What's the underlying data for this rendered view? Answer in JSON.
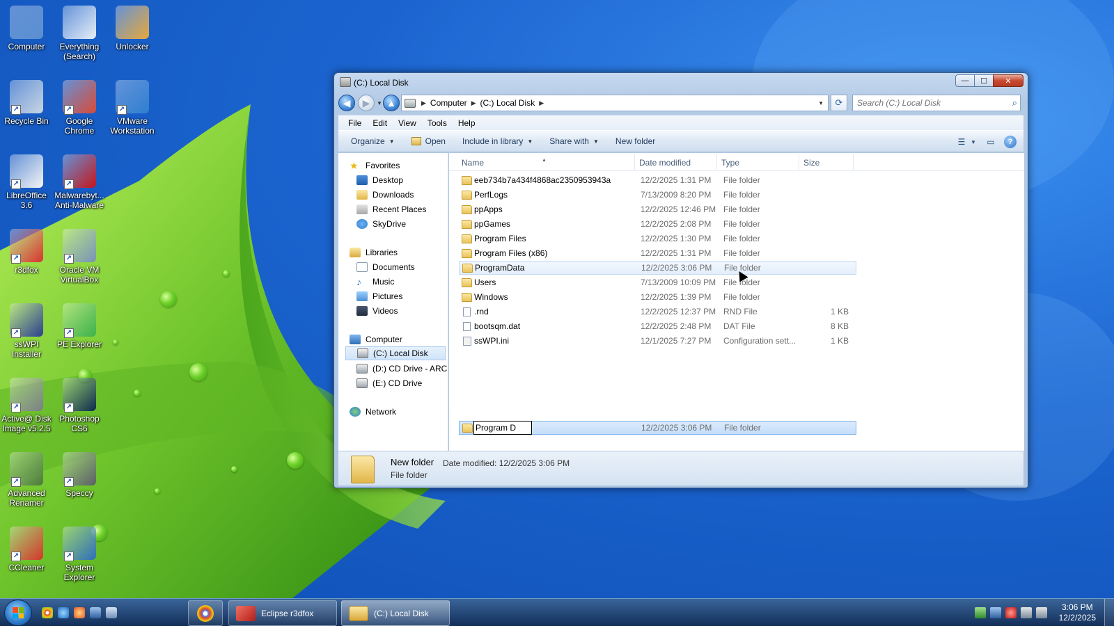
{
  "desktop_icons": [
    {
      "label": "Computer",
      "icon": "computer-icon",
      "color": "#5a8fd0"
    },
    {
      "label": "Everything\n(Search)",
      "icon": "search-icon",
      "color": "#e6eef7"
    },
    {
      "label": "Unlocker",
      "icon": "wand-icon",
      "color": "#e7a83a"
    },
    {
      "label": "Recycle Bin",
      "icon": "recycle-bin-icon",
      "color": "#c9d6e3"
    },
    {
      "label": "Google\nChrome",
      "icon": "chrome-icon",
      "color": "#d84a38"
    },
    {
      "label": "VMware\nWorkstation",
      "icon": "vmware-icon",
      "color": "#2f7fd0"
    },
    {
      "label": "LibreOffice\n3.6",
      "icon": "document-icon",
      "color": "#f4f4f4"
    },
    {
      "label": "Malwarebyt...\nAnti-Malware",
      "icon": "malwarebytes-icon",
      "color": "#c4161c"
    },
    {
      "label": "r3dfox",
      "icon": "fox-icon",
      "color": "#d8332f"
    },
    {
      "label": "Oracle VM\nVirtualBox",
      "icon": "virtualbox-icon",
      "color": "#7a93b8"
    },
    {
      "label": "ssWPI\nInstaller",
      "icon": "installer-icon",
      "color": "#2c3f8f"
    },
    {
      "label": "PE Explorer",
      "icon": "pe-explorer-icon",
      "color": "#3db24a"
    },
    {
      "label": "Active@ Disk\nImage v5.2.5",
      "icon": "disk-image-icon",
      "color": "#7b7f86"
    },
    {
      "label": "Photoshop\nCS6",
      "icon": "photoshop-icon",
      "color": "#0c2a4d"
    },
    {
      "label": "Advanced\nRenamer",
      "icon": "renamer-icon",
      "color": "#4a7a3a"
    },
    {
      "label": "Speccy",
      "icon": "speccy-icon",
      "color": "#5a5f66"
    },
    {
      "label": "CCleaner",
      "icon": "ccleaner-icon",
      "color": "#d4372a"
    },
    {
      "label": "System\nExplorer",
      "icon": "system-explorer-icon",
      "color": "#2f6fb8"
    }
  ],
  "window": {
    "title": "(C:) Local Disk",
    "address": {
      "parts": [
        "Computer",
        "(C:) Local Disk"
      ]
    },
    "search": {
      "placeholder": "Search (C:) Local Disk"
    },
    "menu": [
      "File",
      "Edit",
      "View",
      "Tools",
      "Help"
    ],
    "commands": {
      "organize": "Organize",
      "open": "Open",
      "include": "Include in library",
      "share": "Share with",
      "new_folder": "New folder"
    },
    "nav": {
      "favorites": "Favorites",
      "favorite_items": [
        "Desktop",
        "Downloads",
        "Recent Places",
        "SkyDrive"
      ],
      "libraries": "Libraries",
      "library_items": [
        "Documents",
        "Music",
        "Pictures",
        "Videos"
      ],
      "computer": "Computer",
      "computer_items": [
        "(C:) Local Disk",
        "(D:) CD Drive - ARCH",
        "(E:) CD Drive"
      ],
      "network": "Network"
    },
    "columns": {
      "name": "Name",
      "date": "Date modified",
      "type": "Type",
      "size": "Size"
    },
    "files": [
      {
        "name": "eeb734b7a434f4868ac2350953943a",
        "date": "12/2/2025 1:31 PM",
        "type": "File folder",
        "size": "",
        "kind": "folder"
      },
      {
        "name": "PerfLogs",
        "date": "7/13/2009 8:20 PM",
        "type": "File folder",
        "size": "",
        "kind": "folder"
      },
      {
        "name": "ppApps",
        "date": "12/2/2025 12:46 PM",
        "type": "File folder",
        "size": "",
        "kind": "folder"
      },
      {
        "name": "ppGames",
        "date": "12/2/2025 2:08 PM",
        "type": "File folder",
        "size": "",
        "kind": "folder"
      },
      {
        "name": "Program Files",
        "date": "12/2/2025 1:30 PM",
        "type": "File folder",
        "size": "",
        "kind": "folder"
      },
      {
        "name": "Program Files (x86)",
        "date": "12/2/2025 1:31 PM",
        "type": "File folder",
        "size": "",
        "kind": "folder"
      },
      {
        "name": "ProgramData",
        "date": "12/2/2025 3:06 PM",
        "type": "File folder",
        "size": "",
        "kind": "folder"
      },
      {
        "name": "Users",
        "date": "7/13/2009 10:09 PM",
        "type": "File folder",
        "size": "",
        "kind": "folder"
      },
      {
        "name": "Windows",
        "date": "12/2/2025 1:39 PM",
        "type": "File folder",
        "size": "",
        "kind": "folder"
      },
      {
        "name": ".rnd",
        "date": "12/2/2025 12:37 PM",
        "type": "RND File",
        "size": "1 KB",
        "kind": "file"
      },
      {
        "name": "bootsqm.dat",
        "date": "12/2/2025 2:48 PM",
        "type": "DAT File",
        "size": "8 KB",
        "kind": "file"
      },
      {
        "name": "ssWPI.ini",
        "date": "12/1/2025 7:27 PM",
        "type": "Configuration sett...",
        "size": "1 KB",
        "kind": "ini"
      }
    ],
    "rename_row": {
      "value": "Program D",
      "date": "12/2/2025 3:06 PM",
      "type": "File folder"
    },
    "details": {
      "name": "New folder",
      "modified": "Date modified: 12/2/2025 3:06 PM",
      "type": "File folder"
    }
  },
  "taskbar": {
    "buttons": [
      {
        "label": "",
        "icon": "chrome-icon",
        "color": "#d84a38"
      },
      {
        "label": "Eclipse r3dfox",
        "icon": "fox-icon",
        "color": "#d8332f"
      },
      {
        "label": "(C:) Local Disk",
        "icon": "explorer-icon",
        "color": "#e9c35a"
      }
    ],
    "time": "3:06 PM",
    "date": "12/2/2025"
  }
}
